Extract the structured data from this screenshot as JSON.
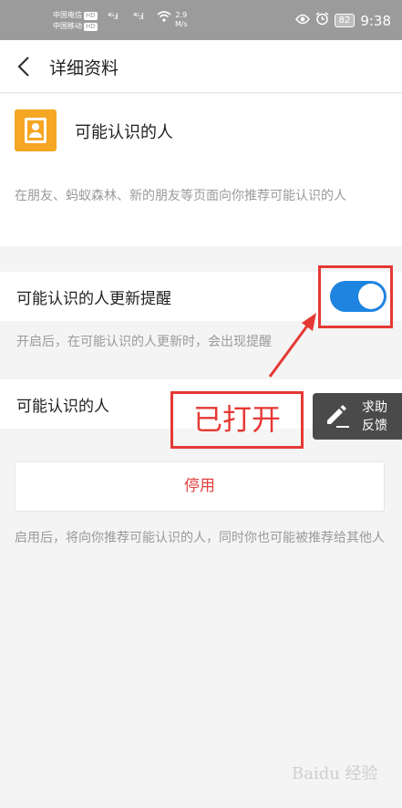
{
  "status_bar": {
    "carrier1": "中国电信",
    "carrier2": "中国移动",
    "hd": "HD",
    "net_speed_value": "2.9",
    "net_speed_unit": "M/s",
    "battery": "82",
    "time": "9:38"
  },
  "header": {
    "title": "详细资料"
  },
  "feature": {
    "name": "可能认识的人",
    "description": "在朋友、蚂蚁森林、新的朋友等页面向你推荐可能认识的人"
  },
  "reminder": {
    "label": "可能认识的人更新提醒",
    "toggle_on": true,
    "hint": "开启后，在可能认识的人更新时，会出现提醒"
  },
  "people_row": {
    "label": "可能认识的人"
  },
  "disable_button": {
    "label": "停用"
  },
  "disable_hint": "启用后，将向你推荐可能认识的人，同时你也可能被推荐给其他人",
  "help_button": {
    "line1": "求助",
    "line2": "反馈"
  },
  "annotation": {
    "text": "已打开",
    "color": "#e53935"
  },
  "watermark": "Baidu 经验",
  "colors": {
    "toggle_on": "#1e84e0",
    "icon_bg": "#f5a623",
    "disable_text": "#e0413e"
  }
}
